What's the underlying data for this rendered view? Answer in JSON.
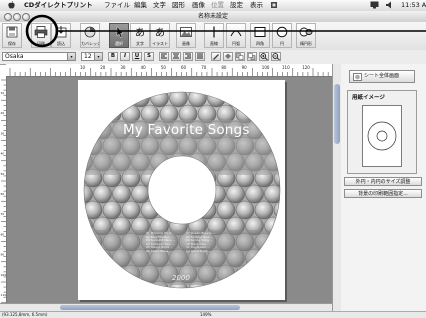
{
  "menubar": {
    "app_name": "CDダイレクトプリント",
    "menus": [
      "ファイル",
      "編集",
      "文字",
      "図形",
      "画像",
      "位置",
      "設定",
      "表示"
    ],
    "clock": "11:53 A"
  },
  "window": {
    "title": "名称未設定"
  },
  "toolbar": {
    "buttons": [
      {
        "label": "保存"
      },
      {
        "label": "印刷"
      },
      {
        "label": "読込"
      },
      {
        "label": "カバレッジ"
      },
      {
        "label": "選択"
      },
      {
        "label": "文字"
      },
      {
        "label": "イラスト"
      },
      {
        "label": "画像"
      },
      {
        "label": "直線"
      },
      {
        "label": "円弧"
      },
      {
        "label": "四角"
      },
      {
        "label": "円"
      },
      {
        "label": "楕円形"
      }
    ]
  },
  "format": {
    "font": "Osaka",
    "size": "12",
    "style_buttons": [
      "B",
      "I",
      "U",
      "S"
    ]
  },
  "ruler": {
    "ticks": [
      "10",
      "20",
      "30",
      "40",
      "50",
      "60",
      "70",
      "80",
      "90",
      "100",
      "110",
      "120"
    ]
  },
  "ruler_left": {
    "ticks": [
      "10",
      "20",
      "30",
      "40",
      "50",
      "60",
      "70",
      "80",
      "90",
      "100",
      "110"
    ]
  },
  "disc": {
    "title": "My Favorite Songs",
    "year": "2000",
    "tracks_col1": [
      "01 Morning Wind  ...",
      "02 Blue Horizon  ...",
      "03 Sunlight Days  ...",
      "04 Summer Rain  ...",
      "05 Starry Night  ...",
      "06 Silent Wave  ..."
    ],
    "tracks_col2": [
      "07 Ocean Breeze  ...",
      "08 Forever Now  ...",
      "09 Spring Song  ...",
      "10 Memories  ...",
      "11 Daydream  ...",
      "12 Good Night  ..."
    ]
  },
  "panel": {
    "fullscreen_button": "シート全体画面",
    "preview_title": "用紙イメージ",
    "size_button": "外円・内円のサイズ調整",
    "print_range_button": "背景の印刷範囲指定..."
  },
  "status": {
    "coords": "(93.125,8mm, 6.5mm)",
    "zoom": "149%"
  }
}
